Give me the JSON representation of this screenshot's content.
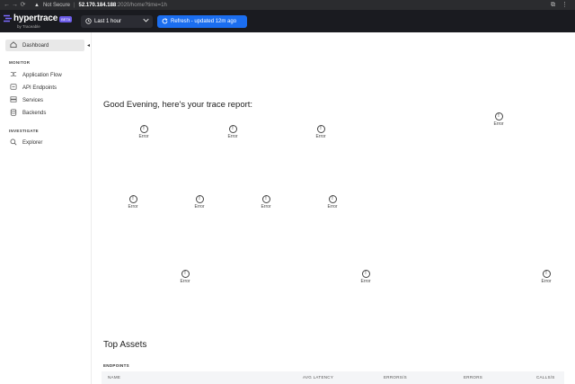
{
  "browser": {
    "back_glyph": "←",
    "forward_glyph": "→",
    "reload_glyph": "⟳",
    "warning_glyph": "▲",
    "not_secure": "Not Secure",
    "sep": "|",
    "url_host": "52.170.184.188",
    "url_path": ":2020/home?time=1h",
    "menu_glyph": "⋮",
    "ext_glyph": "⧉"
  },
  "header": {
    "logo_text": "hypertrace",
    "logo_badge": "BETA",
    "logo_sub": "by Traceable",
    "time_range": "Last 1 hour",
    "refresh_label": "Refresh - updated 12m ago"
  },
  "sidebar": {
    "collapse_glyph": "◂",
    "dashboard": "Dashboard",
    "monitor_section": "MONITOR",
    "items_monitor": [
      "Application Flow",
      "API Endpoints",
      "Services",
      "Backends"
    ],
    "investigate_section": "INVESTIGATE",
    "explorer": "Explorer"
  },
  "main": {
    "greeting": "Good Evening, here's your trace report:",
    "error_label": "Error",
    "top_assets": "Top Assets",
    "endpoints_label": "ENDPOINTS",
    "columns": [
      "NAME",
      "AVG LATENCY",
      "ERRORS/S",
      "ERRORS",
      "CALLS/S"
    ]
  },
  "colors": {
    "header_bg": "#1a1b20",
    "accent_blue": "#1b6ef0",
    "brand_purple": "#7b6bff"
  }
}
